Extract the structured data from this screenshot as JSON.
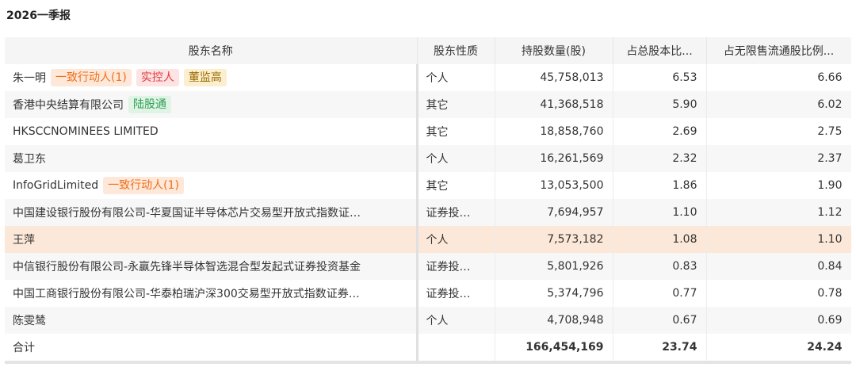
{
  "section": {
    "title": "2026一季报"
  },
  "table": {
    "headers": {
      "name": "股东名称",
      "type": "股东性质",
      "qty": "持股数量(股)",
      "pct_total": "占总股本比...",
      "pct_float": "占无限售流通股比例..."
    },
    "rows": [
      {
        "name": "朱一明",
        "tags": [
          {
            "text": "一致行动人(1)",
            "color": "orange"
          },
          {
            "text": "实控人",
            "color": "red"
          },
          {
            "text": "董监高",
            "color": "gold"
          }
        ],
        "type": "个人",
        "qty": "45,758,013",
        "pct_total": "6.53",
        "pct_float": "6.66"
      },
      {
        "name": "香港中央结算有限公司",
        "tags": [
          {
            "text": "陆股通",
            "color": "green"
          }
        ],
        "type": "其它",
        "qty": "41,368,518",
        "pct_total": "5.90",
        "pct_float": "6.02"
      },
      {
        "name": "HKSCCNOMINEES LIMITED",
        "tags": [],
        "type": "其它",
        "qty": "18,858,760",
        "pct_total": "2.69",
        "pct_float": "2.75"
      },
      {
        "name": "葛卫东",
        "tags": [],
        "type": "个人",
        "qty": "16,261,569",
        "pct_total": "2.32",
        "pct_float": "2.37"
      },
      {
        "name": "InfoGridLimited",
        "tags": [
          {
            "text": "一致行动人(1)",
            "color": "orange"
          }
        ],
        "type": "其它",
        "qty": "13,053,500",
        "pct_total": "1.86",
        "pct_float": "1.90"
      },
      {
        "name": "中国建设银行股份有限公司-华夏国证半导体芯片交易型开放式指数证…",
        "tags": [],
        "type": "证券投…",
        "qty": "7,694,957",
        "pct_total": "1.10",
        "pct_float": "1.12"
      },
      {
        "name": "王萍",
        "tags": [],
        "type": "个人",
        "qty": "7,573,182",
        "pct_total": "1.08",
        "pct_float": "1.10",
        "highlight": true
      },
      {
        "name": "中信银行股份有限公司-永赢先锋半导体智选混合型发起式证券投资基金",
        "tags": [],
        "type": "证券投…",
        "qty": "5,801,926",
        "pct_total": "0.83",
        "pct_float": "0.84"
      },
      {
        "name": "中国工商银行股份有限公司-华泰柏瑞沪深300交易型开放式指数证券…",
        "tags": [],
        "type": "证券投…",
        "qty": "5,374,796",
        "pct_total": "0.77",
        "pct_float": "0.78"
      },
      {
        "name": "陈雯鸶",
        "tags": [],
        "type": "个人",
        "qty": "4,708,948",
        "pct_total": "0.67",
        "pct_float": "0.69"
      }
    ],
    "total": {
      "label": "合计",
      "qty": "166,454,169",
      "pct_total": "23.74",
      "pct_float": "24.24"
    }
  },
  "colors": {
    "orange_tag": "#f06f1a",
    "red_tag": "#e03a3a",
    "gold_tag": "#9c6a00",
    "green_tag": "#2e9e53",
    "highlight_row": "#fce8d8"
  }
}
